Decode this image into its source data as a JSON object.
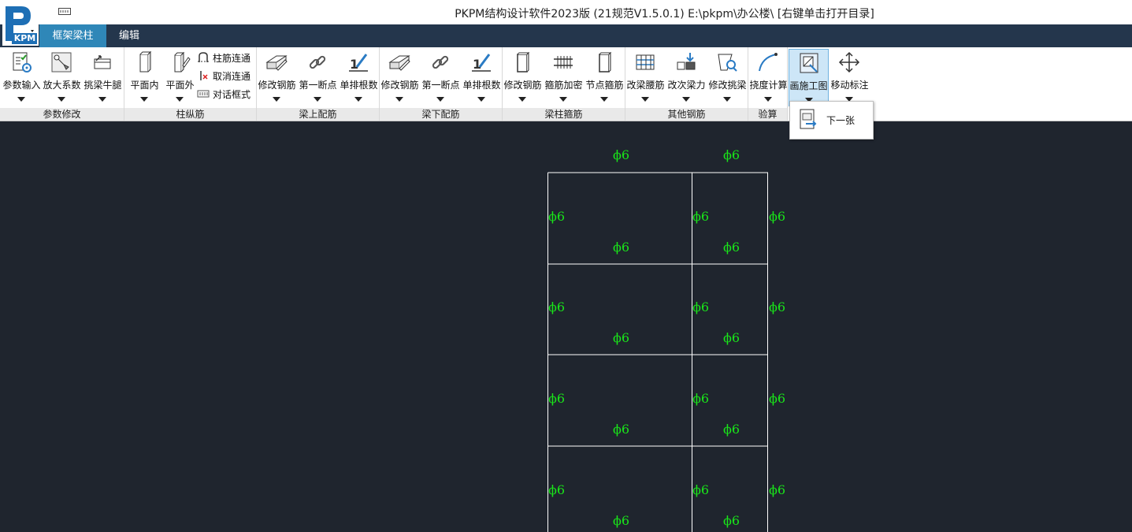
{
  "app": {
    "title": "PKPM结构设计软件2023版 (21规范V1.5.0.1) E:\\pkpm\\办公楼\\ [右键单击打开目录]",
    "logo_text": "KPM"
  },
  "tabs": [
    {
      "label": "框架梁柱",
      "active": true
    },
    {
      "label": "编辑",
      "active": false
    }
  ],
  "ribbon": {
    "groups": [
      {
        "label": "参数修改"
      },
      {
        "label": "柱纵筋"
      },
      {
        "label": "梁上配筋"
      },
      {
        "label": "梁下配筋"
      },
      {
        "label": "梁柱箍筋"
      },
      {
        "label": "其他钢筋"
      },
      {
        "label": "验算"
      }
    ],
    "buttons": [
      {
        "label": "参数输入",
        "icon": "params-icon"
      },
      {
        "label": "放大系数",
        "icon": "wrench-icon"
      },
      {
        "label": "挑梁牛腿",
        "icon": "cantilever-icon"
      },
      {
        "label": "平面内",
        "icon": "column-in-icon"
      },
      {
        "label": "平面外",
        "icon": "column-out-icon"
      },
      {
        "label": "修改钢筋",
        "icon": "beam-edit-icon"
      },
      {
        "label": "第一断点",
        "icon": "link-icon"
      },
      {
        "label": "单排根数",
        "icon": "count-icon"
      },
      {
        "label": "修改钢筋",
        "icon": "beam-edit-icon"
      },
      {
        "label": "第一断点",
        "icon": "link-icon"
      },
      {
        "label": "单排根数",
        "icon": "count-icon"
      },
      {
        "label": "修改钢筋",
        "icon": "stirrup-edit-icon"
      },
      {
        "label": "箍筋加密",
        "icon": "stirrup-dense-icon"
      },
      {
        "label": "节点箍筋",
        "icon": "node-stirrup-icon"
      },
      {
        "label": "改梁腰筋",
        "icon": "waist-bar-icon"
      },
      {
        "label": "改次梁力",
        "icon": "secondary-beam-icon"
      },
      {
        "label": "修改挑梁",
        "icon": "cantilever-edit-icon"
      },
      {
        "label": "挠度计算",
        "icon": "deflection-icon"
      },
      {
        "label": "画施工图",
        "icon": "draw-drawing-icon",
        "active": true
      },
      {
        "label": "移动标注",
        "icon": "move-icon"
      }
    ],
    "small_buttons": [
      {
        "label": "柱筋连通",
        "icon": "connect-icon"
      },
      {
        "label": "取消连通",
        "icon": "disconnect-icon"
      },
      {
        "label": "对话框式",
        "icon": "dialog-icon"
      }
    ]
  },
  "dropdown_menu": {
    "items": [
      {
        "label": "下一张",
        "icon": "next-sheet-icon"
      }
    ]
  },
  "drawing": {
    "rebar_label": "ϕ6",
    "line_color": "#ffffff",
    "label_color": "#19e619"
  }
}
